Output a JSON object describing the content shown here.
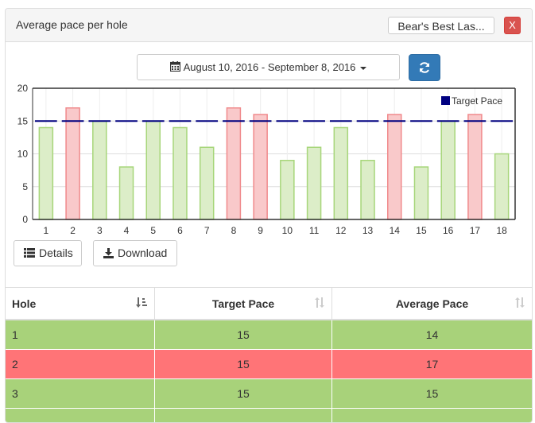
{
  "panel": {
    "title": "Average pace per hole",
    "course_button": "Bear's Best Las...",
    "close_label": "X"
  },
  "date_range": {
    "label": "August 10, 2016 - September 8, 2016"
  },
  "icons": {
    "calendar": "calendar-icon",
    "caret": "caret-down-icon",
    "refresh": "refresh-icon",
    "details": "list-icon",
    "download": "download-icon",
    "sort_active": "sort-numeric-icon",
    "sort": "sort-icon"
  },
  "buttons": {
    "details": "Details",
    "download": "Download"
  },
  "colors": {
    "over_fill": "#f9c9ca",
    "over_stroke": "#f08a8c",
    "under_fill": "#dcedc8",
    "under_stroke": "#a7d67a",
    "target_line": "#000080",
    "row_good": "#a8d27a",
    "row_bad": "#ff7477",
    "refresh_bg": "#337ab7",
    "close_bg": "#d9534f"
  },
  "chart_data": {
    "type": "bar",
    "categories": [
      "1",
      "2",
      "3",
      "4",
      "5",
      "6",
      "7",
      "8",
      "9",
      "10",
      "11",
      "12",
      "13",
      "14",
      "15",
      "16",
      "17",
      "18"
    ],
    "series": [
      {
        "values": [
          14,
          17,
          15,
          8,
          15,
          14,
          11,
          17,
          16,
          9,
          11,
          14,
          9,
          16,
          8,
          15,
          16,
          10
        ]
      },
      {
        "name": "Target Pace",
        "values": [
          15,
          15,
          15,
          15,
          15,
          15,
          15,
          15,
          15,
          15,
          15,
          15,
          15,
          15,
          15,
          15,
          15,
          15
        ],
        "style": "dashed-line"
      }
    ],
    "yticks": [
      0,
      5,
      10,
      15,
      20
    ],
    "ylim": [
      0,
      20
    ],
    "legend": [
      "Target Pace"
    ],
    "legend_position": "top-right",
    "grid": true
  },
  "table": {
    "headers": [
      "Hole",
      "Target Pace",
      "Average Pace"
    ],
    "rows": [
      [
        "1",
        "15",
        "14"
      ],
      [
        "2",
        "15",
        "17"
      ],
      [
        "3",
        "15",
        "15"
      ]
    ]
  }
}
